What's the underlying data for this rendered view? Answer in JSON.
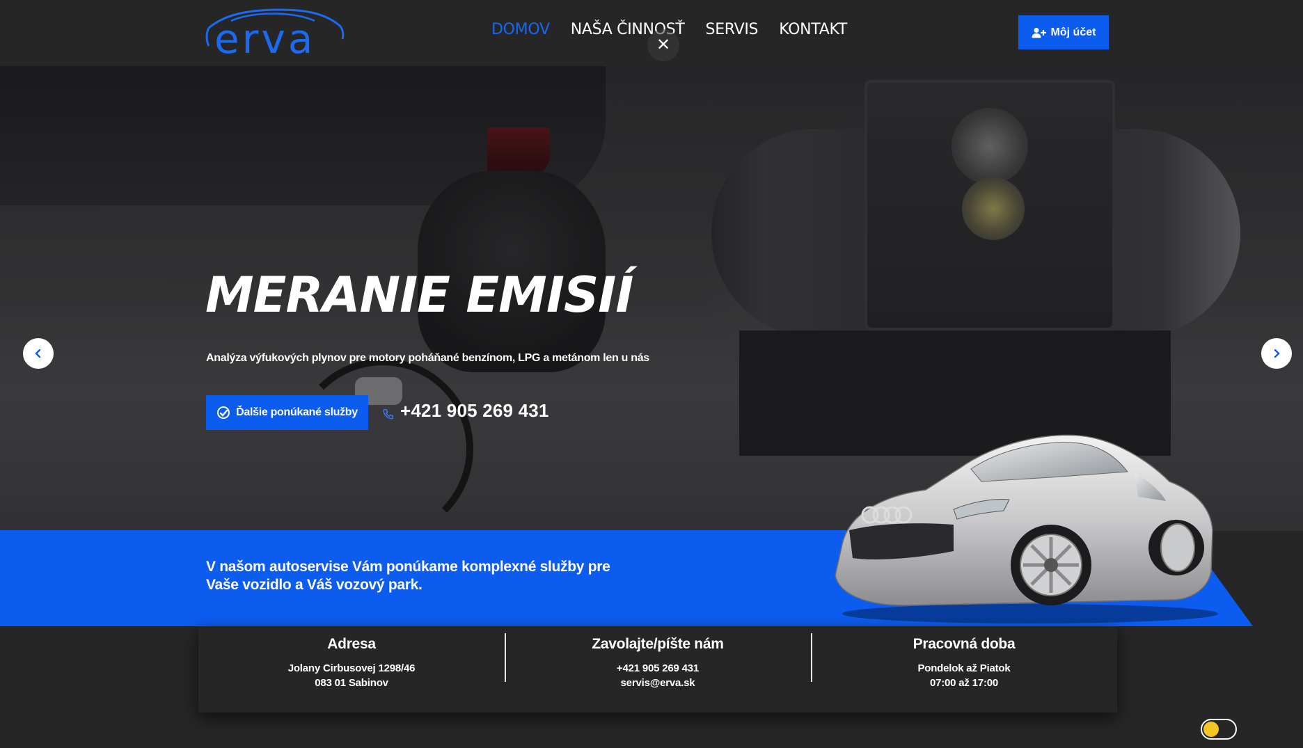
{
  "header": {
    "logo_text": "erva",
    "nav": [
      {
        "label": "DOMOV",
        "active": true
      },
      {
        "label": "NAŠA ČINNOSŤ",
        "active": false
      },
      {
        "label": "SERVIS",
        "active": false
      },
      {
        "label": "KONTAKT",
        "active": false
      }
    ],
    "close_symbol": "✕",
    "account_label": "Môj účet",
    "account_icon": "user-plus-icon"
  },
  "hero": {
    "title": "MERANIE EMISIÍ",
    "subtitle": "Analýza výfukových plynov pre motory poháňané benzínom, LPG a metánom len u nás",
    "cta_label": "Ďalšie ponúkané služby",
    "cta_icon": "car-wrench-icon",
    "phone": "+421 905 269 431",
    "phone_icon": "phone-icon",
    "slides_total": 3,
    "active_slide": 2
  },
  "band": {
    "text": "V našom autoservise Vám ponúkame komplexné služby pre Vaše vozidlo a Váš vozový park."
  },
  "info": [
    {
      "title": "Adresa",
      "line1": "Jolany Cirbusovej 1298/46",
      "line2": "083 01 Sabinov"
    },
    {
      "title": "Zavolajte/píšte nám",
      "line1": "+421 905 269 431",
      "line2": "servis@erva.sk"
    },
    {
      "title": "Pracovná doba",
      "line1": "Pondelok až Piatok",
      "line2": "07:00 až 17:00"
    }
  ],
  "colors": {
    "accent": "#0d5cf0",
    "background": "#262626",
    "text": "#ffffff"
  }
}
